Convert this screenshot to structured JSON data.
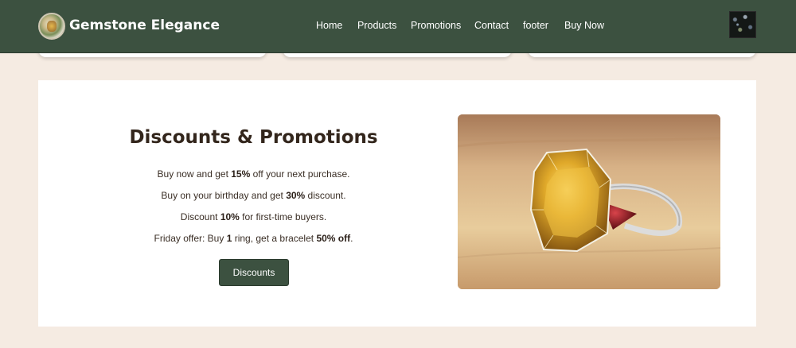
{
  "header": {
    "brand": "Gemstone Elegance",
    "nav": [
      "Home",
      "Products",
      "Promotions",
      "Contact",
      "footer",
      "Buy Now"
    ]
  },
  "promo": {
    "title": "Discounts & Promotions",
    "lines": [
      {
        "before": "Buy now and get ",
        "bold": "15%",
        "after": " off your next purchase."
      },
      {
        "before": "Buy on your birthday and get ",
        "bold": "30%",
        "after": " discount."
      },
      {
        "before": "Discount ",
        "bold": "10%",
        "after": " for first-time buyers."
      },
      {
        "before": "Friday offer: Buy ",
        "bold": "1",
        "mid": " ring, get a bracelet ",
        "bold2": "50% off",
        "after": "."
      }
    ],
    "button_label": "Discounts"
  },
  "colors": {
    "header_bg": "#3c5140",
    "page_bg": "#f5ebe2",
    "button_bg": "#3c5140"
  }
}
